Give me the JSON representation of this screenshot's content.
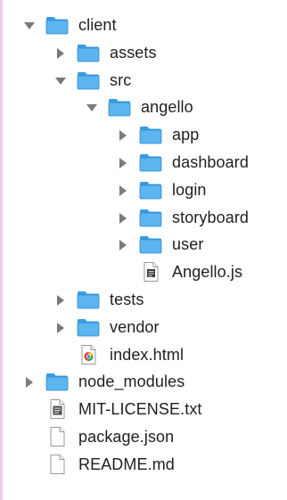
{
  "tree": {
    "items": [
      {
        "label": "client",
        "type": "folder",
        "expanded": true,
        "depth": 0
      },
      {
        "label": "assets",
        "type": "folder",
        "expanded": false,
        "depth": 1
      },
      {
        "label": "src",
        "type": "folder",
        "expanded": true,
        "depth": 1
      },
      {
        "label": "angello",
        "type": "folder",
        "expanded": true,
        "depth": 2
      },
      {
        "label": "app",
        "type": "folder",
        "expanded": false,
        "depth": 3
      },
      {
        "label": "dashboard",
        "type": "folder",
        "expanded": false,
        "depth": 3
      },
      {
        "label": "login",
        "type": "folder",
        "expanded": false,
        "depth": 3
      },
      {
        "label": "storyboard",
        "type": "folder",
        "expanded": false,
        "depth": 3
      },
      {
        "label": "user",
        "type": "folder",
        "expanded": false,
        "depth": 3
      },
      {
        "label": "Angello.js",
        "type": "script-file",
        "depth": 3
      },
      {
        "label": "tests",
        "type": "folder",
        "expanded": false,
        "depth": 1
      },
      {
        "label": "vendor",
        "type": "folder",
        "expanded": false,
        "depth": 1
      },
      {
        "label": "index.html",
        "type": "html-file",
        "depth": 1
      },
      {
        "label": "node_modules",
        "type": "folder",
        "expanded": false,
        "depth": 0
      },
      {
        "label": "MIT-LICENSE.txt",
        "type": "text-file",
        "depth": 0
      },
      {
        "label": "package.json",
        "type": "blank-file",
        "depth": 0
      },
      {
        "label": "README.md",
        "type": "blank-file",
        "depth": 0
      }
    ]
  },
  "colors": {
    "folder_body": "#5bb6ef",
    "folder_tab": "#3a9be0",
    "folder_edge": "#2f88cf",
    "disclosure": "#7a7a7a",
    "text": "#1f1f1f",
    "left_accent": "#f1c9f2"
  },
  "icons": {
    "folder": "folder-icon",
    "script-file": "script-file-icon",
    "html-file": "html-file-icon",
    "text-file": "text-file-icon",
    "blank-file": "blank-file-icon",
    "expanded": "triangle-down-icon",
    "collapsed": "triangle-right-icon"
  }
}
